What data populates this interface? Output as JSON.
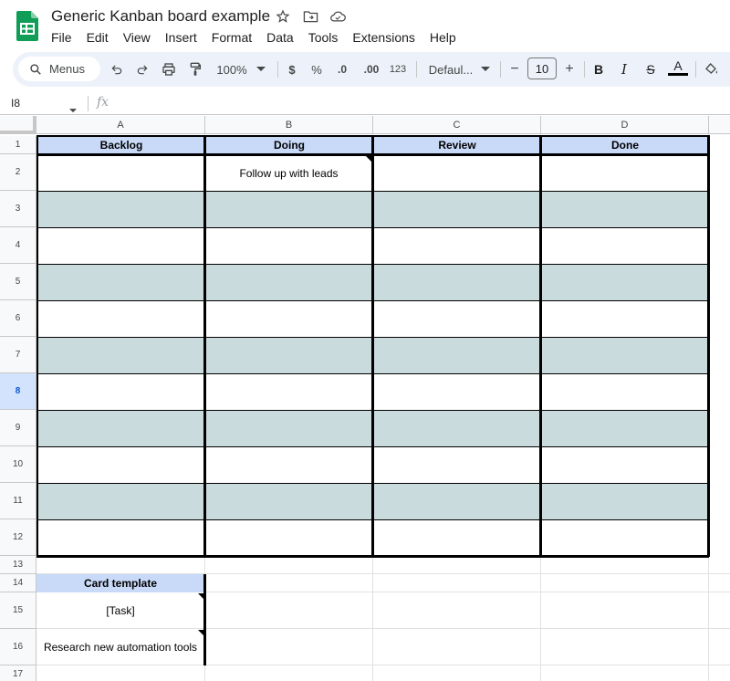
{
  "app": {
    "title": "Generic Kanban board example",
    "logo_icon": "google-sheets-logo",
    "accent_color": "#0f9d58"
  },
  "menu": {
    "items": [
      "File",
      "Edit",
      "View",
      "Insert",
      "Format",
      "Data",
      "Tools",
      "Extensions",
      "Help"
    ]
  },
  "toolbar": {
    "search_label": "Menus",
    "zoom": "100%",
    "currency": "$",
    "percent": "%",
    "decrease_decimal": ".0",
    "increase_decimal": ".00",
    "number_format": "123",
    "font_family": "Defaul...",
    "font_size_minus": "−",
    "font_size": "10",
    "font_size_plus": "+",
    "bold": "B",
    "italic": "I",
    "strikethrough": "S",
    "text_color": "A"
  },
  "formula_bar": {
    "name_box": "I8",
    "fx": "fx"
  },
  "columns": [
    "A",
    "B",
    "C",
    "D"
  ],
  "rows": [
    "1",
    "2",
    "3",
    "4",
    "5",
    "6",
    "7",
    "8",
    "9",
    "10",
    "11",
    "12",
    "13",
    "14",
    "15",
    "16",
    "17"
  ],
  "active_row": "8",
  "board": {
    "headers": [
      "Backlog",
      "Doing",
      "Review",
      "Done"
    ],
    "header_color": "#c9daf8",
    "band_color": "#c9dbdc",
    "cards": {
      "doing_row2": "Follow up with leads"
    }
  },
  "template": {
    "header": "Card template",
    "row15": "[Task]",
    "row16": "Research new automation tools"
  }
}
